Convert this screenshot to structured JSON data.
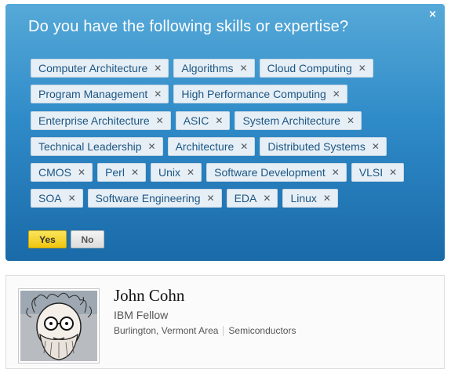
{
  "prompt": {
    "question": "Do you have the following skills or expertise?",
    "close_icon": "×",
    "remove_icon": "✕",
    "skill_rows": [
      [
        "Computer Architecture",
        "Algorithms",
        "Cloud Computing"
      ],
      [
        "Program Management",
        "High Performance Computing"
      ],
      [
        "Enterprise Architecture",
        "ASIC",
        "System Architecture"
      ],
      [
        "Technical Leadership",
        "Architecture",
        "Distributed Systems"
      ],
      [
        "CMOS",
        "Perl",
        "Unix",
        "Software Development",
        "VLSI"
      ],
      [
        "SOA",
        "Software Engineering",
        "EDA",
        "Linux"
      ]
    ],
    "yes_label": "Yes",
    "no_label": "No"
  },
  "profile": {
    "name": "John Cohn",
    "headline": "IBM Fellow",
    "location": "Burlington, Vermont Area",
    "industry": "Semiconductors"
  },
  "colors": {
    "panel_top": "#56a9d8",
    "panel_bottom": "#1a6aa8",
    "tag_text": "#1c5683",
    "yes_button": "#f0c60e"
  }
}
